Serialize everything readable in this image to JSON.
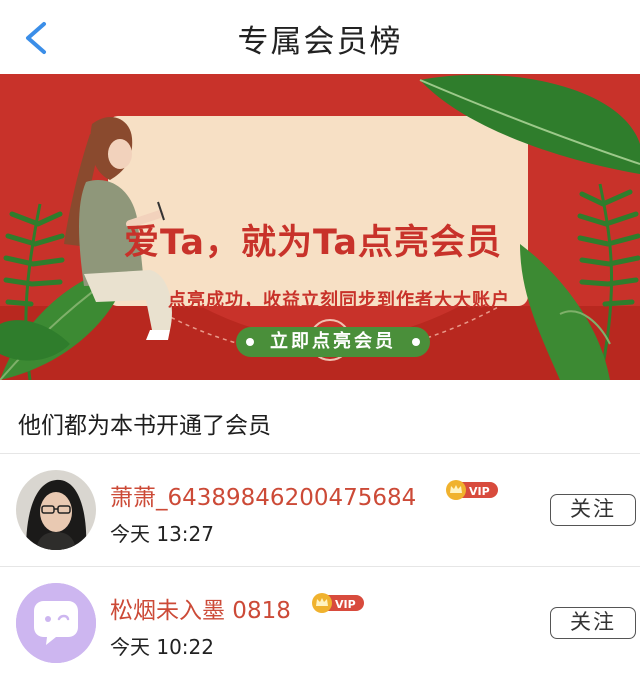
{
  "header": {
    "title": "专属会员榜"
  },
  "banner": {
    "headline": "爱Ta，就为Ta点亮会员",
    "subtitle": "点亮成功，收益立刻同步到作者大大账户",
    "cta_label": "立即点亮会员"
  },
  "section": {
    "title": "他们都为本书开通了会员"
  },
  "members": [
    {
      "name": "萧萧_64389846200475684",
      "badge": "VIP",
      "time": "今天 13:27",
      "follow_label": "关注"
    },
    {
      "name": "松烟未入墨 0818",
      "badge": "VIP",
      "time": "今天 10:22",
      "follow_label": "关注"
    }
  ],
  "colors": {
    "banner_red": "#c8322a",
    "cream": "#f7e0c5",
    "leaf_green": "#2f7d2c",
    "cta_green": "#4a8f3a",
    "name_red": "#cc4a37",
    "back_blue": "#3b8ee8"
  },
  "icons": [
    "chevron-left-icon",
    "vip-crown-icon",
    "chat-bubble-icon",
    "heart-seal-icon"
  ]
}
